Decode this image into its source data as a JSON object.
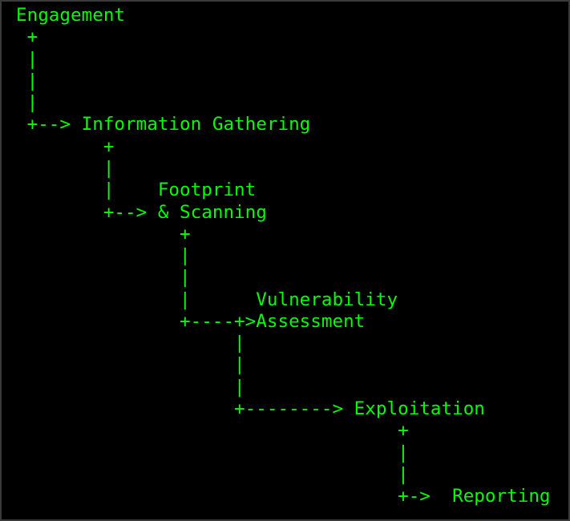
{
  "diagram": {
    "text_color": "#00ff00",
    "background_color": "#000000",
    "lines": [
      "Engagement",
      " +",
      " |",
      " |",
      " |",
      " +--> Information Gathering",
      "        +",
      "        |",
      "        |    Footprint",
      "        +--> & Scanning",
      "               +",
      "               |",
      "               |",
      "               |      Vulnerability",
      "               +----+>Assessment",
      "                    |",
      "                    |",
      "                    |",
      "                    +--------> Exploitation",
      "                                   +",
      "                                   |",
      "                                   |",
      "                                   +->  Reporting"
    ]
  }
}
